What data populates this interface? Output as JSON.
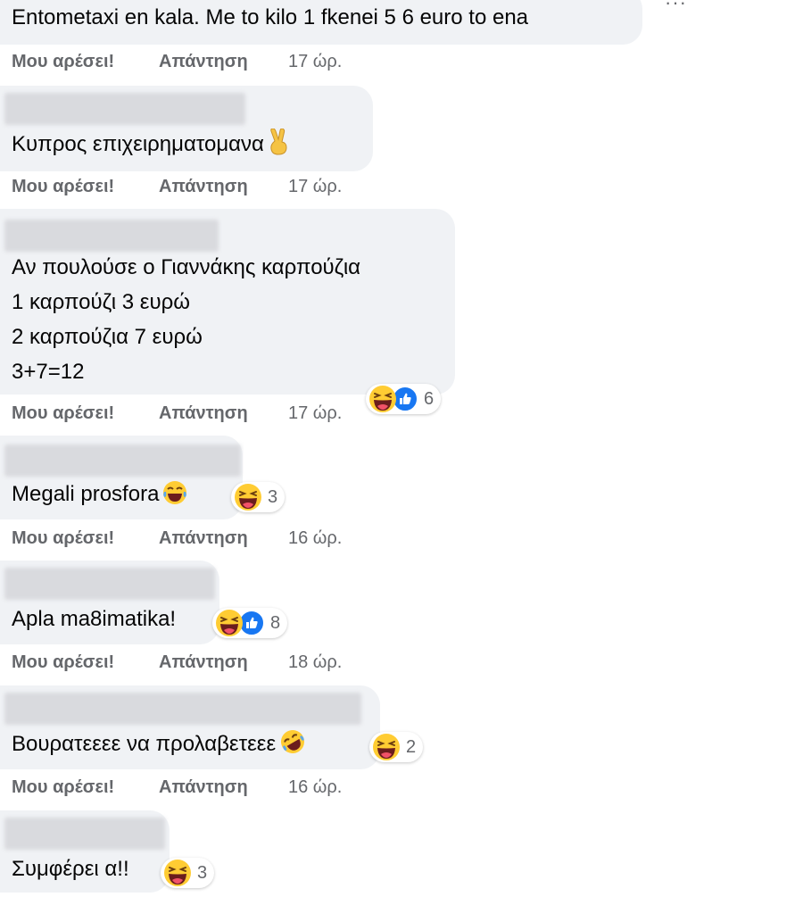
{
  "more_label": "···",
  "comments": [
    {
      "lines": [
        "Entometaxi en kala. Me to kilo 1 fkenei 5 6 euro to ena"
      ],
      "like_label": "Μου αρέσει!",
      "reply_label": "Απάντηση",
      "time": "17 ώρ."
    },
    {
      "lines": [
        "Κυπρος επιχειρηματομανα"
      ],
      "inline_emoji": "victory-hand-icon",
      "like_label": "Μου αρέσει!",
      "reply_label": "Απάντηση",
      "time": "17 ώρ."
    },
    {
      "lines": [
        "Αν πουλούσε ο Γιαννάκης καρπούζια",
        "1 καρπούζι 3 ευρώ",
        "2 καρπούζια 7 ευρώ",
        "3+7=12"
      ],
      "like_label": "Μου αρέσει!",
      "reply_label": "Απάντηση",
      "time": "17 ώρ.",
      "reactions": {
        "types": [
          "haha-reaction-icon",
          "like-reaction-icon"
        ],
        "count": "6"
      }
    },
    {
      "lines": [
        "Megali prosfora"
      ],
      "inline_emoji": "tears-of-joy-icon",
      "like_label": "Μου αρέσει!",
      "reply_label": "Απάντηση",
      "time": "16 ώρ.",
      "reactions": {
        "types": [
          "haha-reaction-icon"
        ],
        "count": "3"
      }
    },
    {
      "lines": [
        "Apla ma8imatika!"
      ],
      "like_label": "Μου αρέσει!",
      "reply_label": "Απάντηση",
      "time": "18 ώρ.",
      "reactions": {
        "types": [
          "haha-reaction-icon",
          "like-reaction-icon"
        ],
        "count": "8"
      }
    },
    {
      "lines": [
        "Βουρατεεεε να προλαβετεεε"
      ],
      "inline_emoji": "rofl-icon",
      "like_label": "Μου αρέσει!",
      "reply_label": "Απάντηση",
      "time": "16 ώρ.",
      "reactions": {
        "types": [
          "haha-reaction-icon"
        ],
        "count": "2"
      }
    },
    {
      "lines": [
        "Συμφέρει α!!"
      ],
      "reactions": {
        "types": [
          "haha-reaction-icon"
        ],
        "count": "3"
      }
    }
  ],
  "colors": {
    "bubble": "#f0f2f5",
    "meta_text": "#65676b",
    "like_blue": "#1877f2",
    "emoji_yellow": "#ffcc33"
  }
}
